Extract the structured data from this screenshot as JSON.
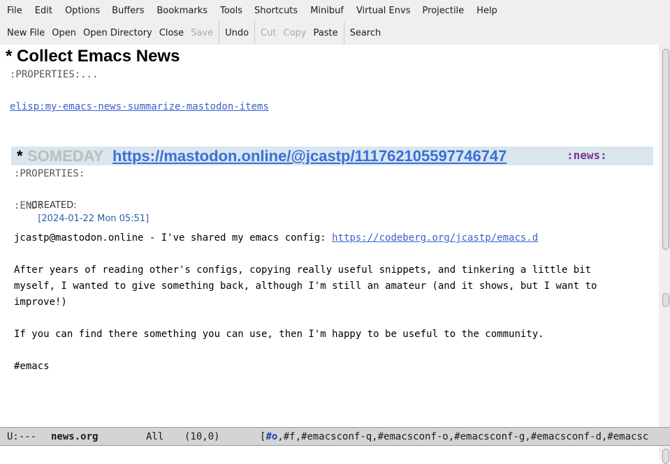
{
  "menubar": {
    "items": [
      "File",
      "Edit",
      "Options",
      "Buffers",
      "Bookmarks",
      "Tools",
      "Shortcuts",
      "Minibuf",
      "Virtual Envs",
      "Projectile",
      "Help"
    ]
  },
  "toolbar": {
    "new_file": "New File",
    "open": "Open",
    "open_directory": "Open Directory",
    "close": "Close",
    "save": "Save",
    "undo": "Undo",
    "cut": "Cut",
    "copy": "Copy",
    "paste": "Paste",
    "search": "Search"
  },
  "buffer": {
    "heading1": "* Collect Emacs News",
    "properties_folded": ":PROPERTIES:...",
    "elisp_link": "elisp:my-emacs-news-summarize-mastodon-items",
    "heading2": {
      "star": "*",
      "keyword": "SOMEDAY",
      "link": "https://mastodon.online/@jcastp/111762105597746747",
      "tag": ":news:"
    },
    "properties_open": ":PROPERTIES:",
    "created_label": ":CREATED:",
    "created_date": "[2024-01-22 Mon 05:51]",
    "end": ":END:",
    "post_prefix": "jcastp@mastodon.online - I've shared my emacs config: ",
    "post_link": "https://codeberg.org/jcastp/emacs.d",
    "para1_line1": "After years of reading other's configs, copying really useful snippets, and tinkering a little bit",
    "para1_line2": "myself, I wanted to give something back, although I'm still an amateur (and it shows, but I want to",
    "para1_line3": "improve!)",
    "para2": "If you can find there something you can use, then I'm happy to be useful to the community.",
    "hashtag": "#emacs"
  },
  "modeline": {
    "status": "U:---",
    "buffer_name": "news.org",
    "position": "All",
    "line_col": "(10,0)",
    "bracket_open": "[",
    "highlight": "#o",
    "rest": ",#f,#emacsconf-q,#emacsconf-o,#emacsconf-g,#emacsconf-d,#emacsc"
  }
}
